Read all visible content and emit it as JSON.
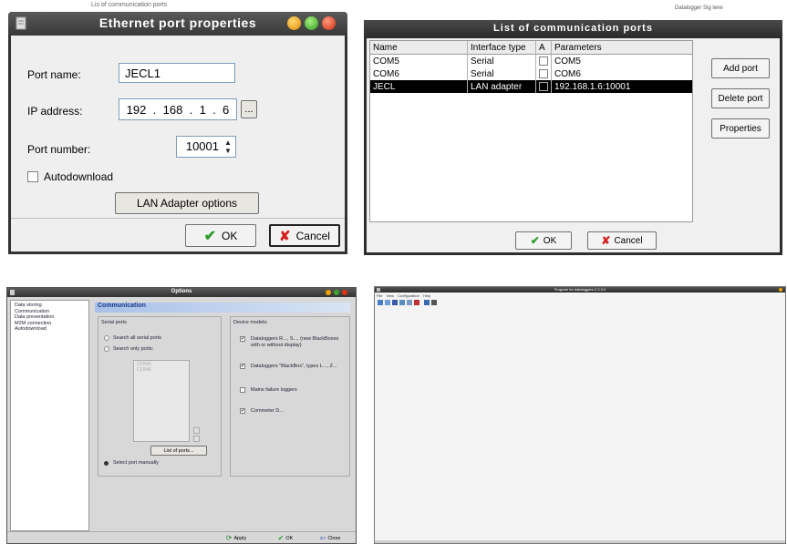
{
  "background_text": {
    "behind_top_left": "Lis of communication ports",
    "behind_top_right": "Datalogger Sig lene"
  },
  "ethernet_dialog": {
    "title": "Ethernet port properties",
    "port_name_label": "Port name:",
    "port_name_value": "JECL1",
    "ip_label": "IP address:",
    "ip_octets": [
      "192",
      "168",
      "1",
      "6"
    ],
    "ip_browse_label": "...",
    "port_number_label": "Port number:",
    "port_number_value": "10001",
    "autodownload_label": "Autodownload",
    "lan_options_label": "LAN Adapter options",
    "ok_label": "OK",
    "cancel_label": "Cancel",
    "colors": {
      "titlebar": "#4a4a4a",
      "ok_check": "#2e9e2e",
      "cancel_x": "#d42020"
    }
  },
  "ports_dialog": {
    "title": "List of communication ports",
    "columns": [
      "Name",
      "Interface type",
      "A",
      "Parameters"
    ],
    "rows": [
      {
        "name": "COM5",
        "interface": "Serial",
        "params": "COM5",
        "selected": false
      },
      {
        "name": "COM6",
        "interface": "Serial",
        "params": "COM6",
        "selected": false
      },
      {
        "name": "JECL",
        "interface": "LAN adapter",
        "params": "192.168.1.6:10001",
        "selected": true
      }
    ],
    "add_port_label": "Add port",
    "delete_port_label": "Delete port",
    "properties_label": "Properties",
    "ok_label": "OK",
    "cancel_label": "Cancel"
  },
  "options_dialog": {
    "title": "Options",
    "nav_items": [
      "Data storing",
      "Communication",
      "Data presentation",
      "M2M connection",
      "Autodownload"
    ],
    "section_title": "Communication",
    "serial_ports_legend": "Serial ports",
    "search_all_label": "Search all serial ports",
    "search_only_label": "Search only ports:",
    "port_list": [
      "COM5",
      "COM6"
    ],
    "select_manually_label": "Select port manually",
    "list_ports_label": "List of ports...",
    "device_models_legend": "Device models:",
    "device_models": [
      {
        "label": "Dataloggers R..., S..., (new BlackBoxes with or without display)",
        "checked": true
      },
      {
        "label": "Dataloggers \"BlackBox\", types L..., Z...",
        "checked": true
      },
      {
        "label": "Mains failure loggers",
        "checked": false
      },
      {
        "label": "Commeter D...",
        "checked": true
      }
    ],
    "apply_label": "Apply",
    "ok_label": "OK",
    "close_label": "Close"
  },
  "main_app": {
    "title": "Program for dataloggers 2.2.3.0",
    "menu": [
      "File",
      "View",
      "Configuration",
      "Help"
    ],
    "toolbar_icons": [
      "new-icon",
      "open-icon",
      "save-icon",
      "download-icon",
      "print-icon",
      "chart-icon",
      "help-icon",
      "info-icon"
    ]
  }
}
